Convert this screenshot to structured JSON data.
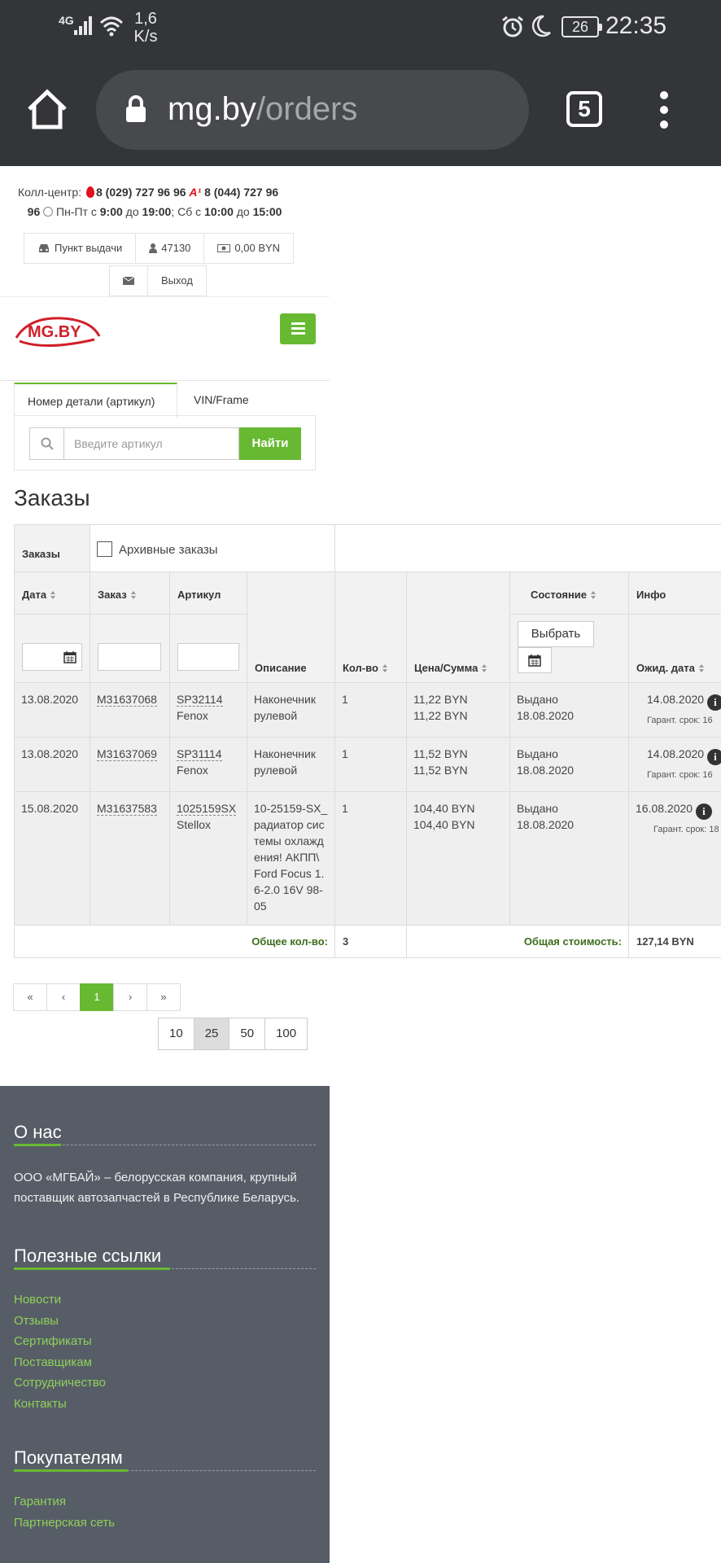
{
  "status_bar": {
    "network": "4G",
    "speed_value": "1,6",
    "speed_unit": "K/s",
    "battery": "26",
    "time": "22:35"
  },
  "browser": {
    "url_domain": "mg.by",
    "url_path": "/orders",
    "tab_count": "5"
  },
  "header": {
    "call_center_label": "Колл-центр:",
    "phone1": "8 (029) 727 96 96",
    "phone2_a": "8 (044) 727 96",
    "phone2_b": "96",
    "hours_pre": "Пн-Пт с",
    "hours_1": "9:00",
    "hours_to": "до",
    "hours_2": "19:00",
    "hours_sat": "; Сб с",
    "hours_3": "10:00",
    "hours_to2": "до",
    "hours_4": "15:00"
  },
  "userbar": {
    "pickup": "Пункт выдачи",
    "user_id": "47130",
    "balance": "0,00 BYN",
    "logout": "Выход"
  },
  "logo_text": "MG.BY",
  "search": {
    "tab_article": "Номер детали (артикул)",
    "tab_vin": "VIN/Frame",
    "placeholder": "Введите артикул",
    "button": "Найти"
  },
  "page_title": "Заказы",
  "orders": {
    "section_label": "Заказы",
    "archive_label": "Архивные заказы",
    "columns": {
      "date": "Дата",
      "order": "Заказ",
      "article": "Артикул",
      "description": "Описание",
      "qty": "Кол-во",
      "price": "Цена/Сумма",
      "status": "Состояние",
      "info": "Инфо",
      "expected_date": "Ожид. дата"
    },
    "select_button": "Выбрать",
    "rows": [
      {
        "date": "13.08.2020",
        "order": "M31637068",
        "article": "SP32114",
        "brand": "Fenox",
        "description": "Наконечник рулевой",
        "qty": "1",
        "price": "11,22 BYN",
        "sum": "11,22 BYN",
        "status": "Выдано",
        "status_date": "18.08.2020",
        "expected": "14.08.2020",
        "garant": "Гарант. срок: 16"
      },
      {
        "date": "13.08.2020",
        "order": "M31637069",
        "article": "SP31114",
        "brand": "Fenox",
        "description": "Наконечник рулевой",
        "qty": "1",
        "price": "11,52 BYN",
        "sum": "11,52 BYN",
        "status": "Выдано",
        "status_date": "18.08.2020",
        "expected": "14.08.2020",
        "garant": "Гарант. срок: 16"
      },
      {
        "date": "15.08.2020",
        "order": "M31637583",
        "article": "1025159SX",
        "brand": "Stellox",
        "description": "10-25159-SX_радиатор системы охлаждения! АКПП\\ Ford Focus 1.6-2.0 16V 98-05",
        "qty": "1",
        "price": "104,40 BYN",
        "sum": "104,40 BYN",
        "status": "Выдано",
        "status_date": "18.08.2020",
        "expected": "16.08.2020",
        "garant": "Гарант. срок: 18"
      }
    ],
    "total_qty_label": "Общее кол-во:",
    "total_qty": "3",
    "total_cost_label": "Общая стоимость:",
    "total_cost": "127,14 BYN"
  },
  "pagination": {
    "first": "«",
    "prev": "‹",
    "current": "1",
    "next": "›",
    "last": "»",
    "per_page": [
      "10",
      "25",
      "50",
      "100"
    ],
    "per_page_selected": "25"
  },
  "footer": {
    "about_title": "О нас",
    "about_text": "ООО «МГБАЙ» – белорусская компания, крупный поставщик автозапчастей в Республике Беларусь.",
    "links_title": "Полезные ссылки",
    "links": [
      "Новости",
      "Отзывы",
      "Сертификаты",
      "Поставщикам",
      "Сотрудничество",
      "Контакты"
    ],
    "buyers_title": "Покупателям",
    "buyer_links": [
      "Гарантия",
      "Партнерская сеть"
    ]
  },
  "colors": {
    "accent_green": "#67b932",
    "footer_bg": "#575d67",
    "chrome_bg": "#333538"
  }
}
